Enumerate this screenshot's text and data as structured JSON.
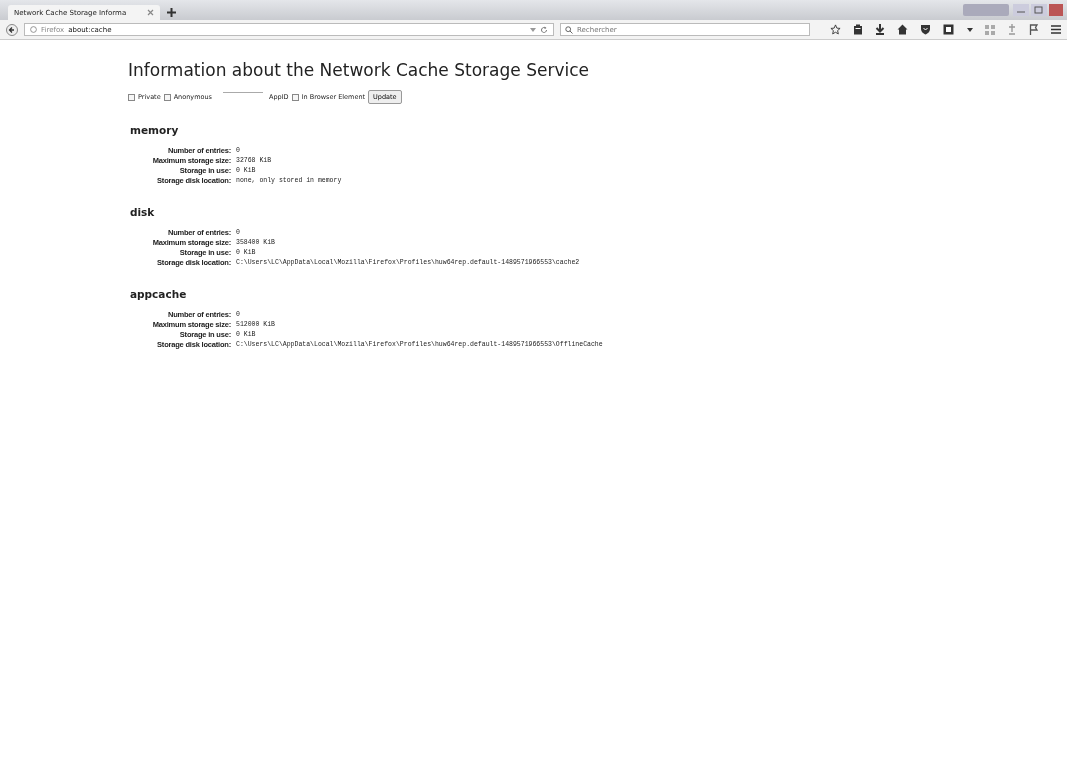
{
  "tabs": [
    {
      "label": "Network Cache Storage Informa",
      "selected": true
    }
  ],
  "address_bar": {
    "identity": "Firefox",
    "url": "about:cache"
  },
  "search": {
    "placeholder": "Rechercher"
  },
  "title": "Information about the Network Cache Storage Service",
  "options": [
    {
      "kind": "checkbox",
      "label": "Private",
      "checked": false
    },
    {
      "kind": "checkbox",
      "label": "Anonymous",
      "checked": false
    },
    {
      "kind": "field",
      "label": "AppID"
    },
    {
      "kind": "checkbox",
      "label": "In Browser Element",
      "checked": false
    },
    {
      "kind": "button",
      "label": "Update"
    }
  ],
  "sections": [
    {
      "name": "memory",
      "rows": [
        {
          "label": "Number of entries:",
          "value": "0"
        },
        {
          "label": "Maximum storage size:",
          "value": "32768 KiB"
        },
        {
          "label": "Storage in use:",
          "value": "0 KiB"
        },
        {
          "label": "Storage disk location:",
          "value": "none, only stored in memory"
        }
      ]
    },
    {
      "name": "disk",
      "rows": [
        {
          "label": "Number of entries:",
          "value": "0"
        },
        {
          "label": "Maximum storage size:",
          "value": "358400 KiB"
        },
        {
          "label": "Storage in use:",
          "value": "0 KiB"
        },
        {
          "label": "Storage disk location:",
          "value": "C:\\Users\\LC\\AppData\\Local\\Mozilla\\Firefox\\Profiles\\huw64rep.default-1489571966553\\cache2"
        }
      ]
    },
    {
      "name": "appcache",
      "rows": [
        {
          "label": "Number of entries:",
          "value": "0"
        },
        {
          "label": "Maximum storage size:",
          "value": "512000 KiB"
        },
        {
          "label": "Storage in use:",
          "value": "0 KiB"
        },
        {
          "label": "Storage disk location:",
          "value": "C:\\Users\\LC\\AppData\\Local\\Mozilla\\Firefox\\Profiles\\huw64rep.default-1489571966553\\OfflineCache"
        }
      ]
    }
  ]
}
